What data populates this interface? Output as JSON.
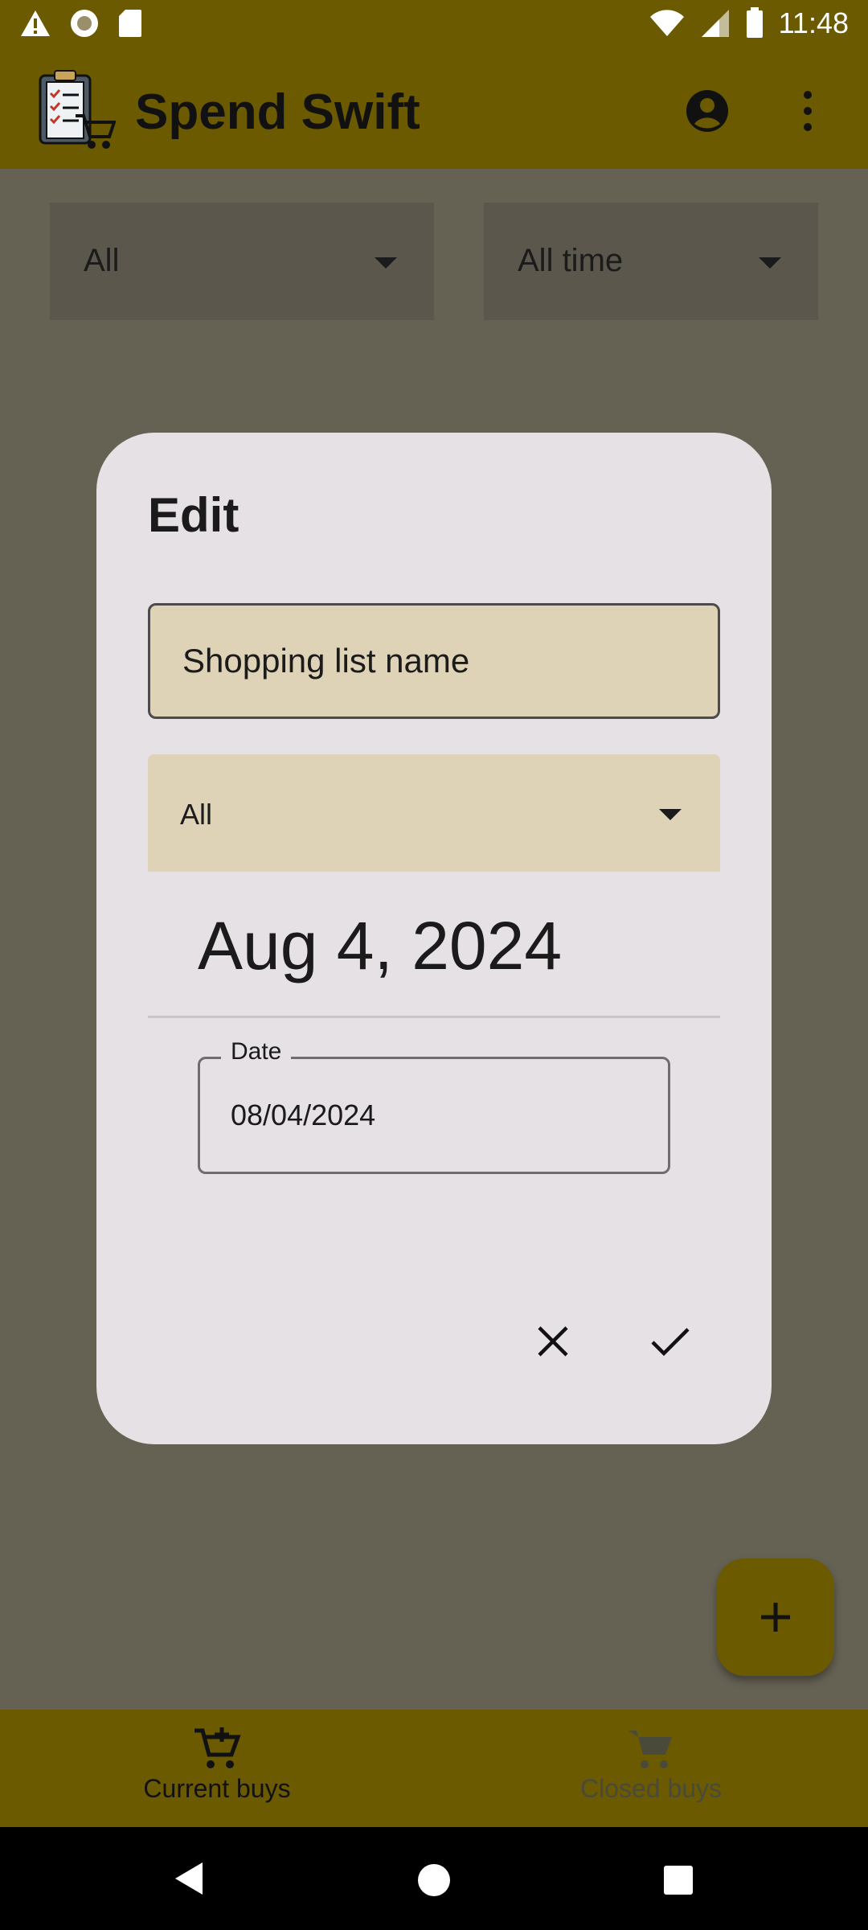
{
  "status_bar": {
    "time": "11:48"
  },
  "app_bar": {
    "title": "Spend Swift"
  },
  "filters": {
    "category": "All",
    "period": "All time"
  },
  "dialog": {
    "title": "Edit",
    "name_placeholder": "Shopping list name",
    "category_value": "All",
    "date_display": "Aug 4, 2024",
    "date_label": "Date",
    "date_value": "08/04/2024"
  },
  "bottom_nav": {
    "items": [
      {
        "label": "Current buys",
        "active": true
      },
      {
        "label": "Closed buys",
        "active": false
      }
    ]
  },
  "colors": {
    "accent": "#6b5a00",
    "field": "#ded2b7",
    "dialog": "#e6e1e5"
  }
}
